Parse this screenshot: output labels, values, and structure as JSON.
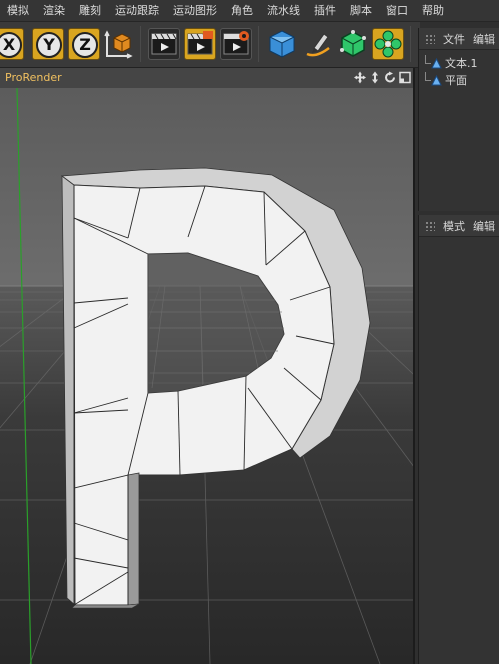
{
  "menu": {
    "items": [
      "模拟",
      "渲染",
      "雕刻",
      "运动跟踪",
      "运动图形",
      "角色",
      "流水线",
      "插件",
      "脚本",
      "窗口",
      "帮助"
    ]
  },
  "toolbar": {
    "axis_x": "X",
    "axis_y": "Y",
    "axis_z": "Z",
    "icons": [
      "x-axis-icon",
      "y-axis-icon",
      "z-axis-icon",
      "coordinate-system-icon",
      "render-view-icon",
      "render-picture-viewer-icon",
      "render-settings-icon",
      "cube-icon",
      "pen-icon",
      "subdivision-icon",
      "cloner-icon"
    ]
  },
  "objects_panel": {
    "tabs": [
      "文件",
      "编辑"
    ],
    "items": [
      {
        "name": "文本.1",
        "icon": "text-icon"
      },
      {
        "name": "平面",
        "icon": "plane-icon"
      }
    ]
  },
  "attributes_panel": {
    "tabs": [
      "模式",
      "编辑"
    ]
  },
  "viewport": {
    "title": "ProRender",
    "icons": [
      "move-view-icon",
      "zoom-view-icon",
      "rotate-view-icon",
      "maximize-view-icon"
    ]
  },
  "colors": {
    "accent": "#d9a520",
    "viewport_title": "#f0c060",
    "y_axis": "#2aa02a"
  }
}
